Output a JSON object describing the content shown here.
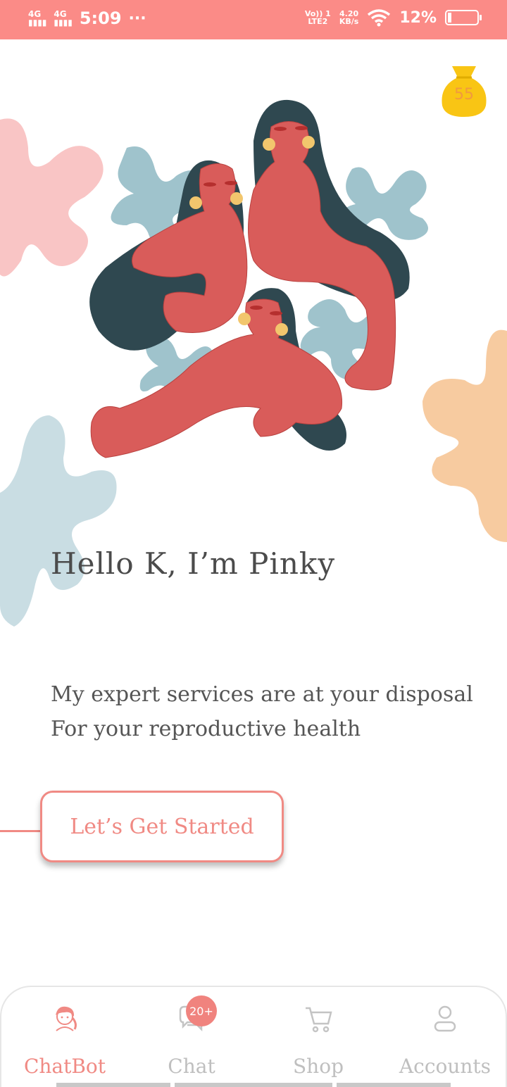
{
  "status_bar": {
    "signal1": "4G",
    "signal2": "4G",
    "time": "5:09",
    "dots": "···",
    "network_top": "Vo)) 1",
    "network_bottom": "LTE2",
    "speed_top": "4.20",
    "speed_bottom": "KB/s",
    "battery": "12%",
    "battery_level": 0.12
  },
  "coins": {
    "count": "55",
    "icon": "money-bag-icon"
  },
  "hero": {
    "greeting": "Hello K, I’m Pinky",
    "line1": "My expert services are at your disposal",
    "line2": "For your reproductive health",
    "cta": "Let’s Get Started"
  },
  "nav": {
    "items": [
      {
        "label": "ChatBot",
        "icon": "chatbot-avatar-icon",
        "active": true
      },
      {
        "label": "Chat",
        "icon": "chat-bubbles-icon",
        "badge": "20+"
      },
      {
        "label": "Shop",
        "icon": "cart-icon"
      },
      {
        "label": "Accounts",
        "icon": "user-icon"
      }
    ]
  },
  "colors": {
    "accent": "#f08a84",
    "status_bar": "#fb8b87",
    "figure": "#d95c5a",
    "hair": "#2f4850",
    "leaf_blue": "#9fc3cc",
    "leaf_pink": "#f9c5c5",
    "leaf_peach": "#f7cba0",
    "coin": "#f9c514"
  }
}
